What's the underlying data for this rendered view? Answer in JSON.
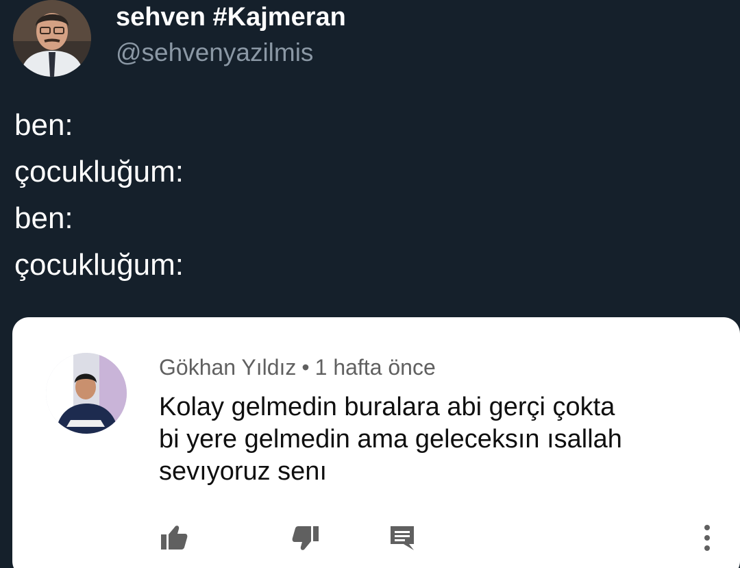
{
  "tweet": {
    "author_name": "sehven #Kajmeran",
    "author_handle": "@sehvenyazilmis",
    "avatar_icon": "profile-photo",
    "lines": [
      "ben:",
      "çocukluğum:",
      "ben:",
      "çocukluğum:"
    ]
  },
  "comment": {
    "author": "Gökhan Yıldız",
    "separator": "•",
    "time": "1 hafta önce",
    "avatar_icon": "profile-photo",
    "lines": [
      "Kolay gelmedin buralara abi gerçi çokta",
      "bi yere gelmedin ama geleceksın ısallah",
      "sevıyoruz senı"
    ],
    "actions": [
      "thumbs-up-icon",
      "thumbs-down-icon",
      "reply-icon",
      "more-vertical-icon"
    ]
  },
  "colors": {
    "background": "#15202b",
    "card": "#ffffff",
    "handle": "#8b98a5",
    "meta": "#606060",
    "icon": "#606060"
  }
}
